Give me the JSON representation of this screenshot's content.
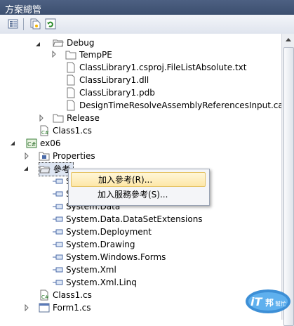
{
  "window": {
    "title": "方案總管"
  },
  "tree": {
    "debug": "Debug",
    "temppe": "TempPE",
    "file1": "ClassLibrary1.csproj.FileListAbsolute.txt",
    "file2": "ClassLibrary1.dll",
    "file3": "ClassLibrary1.pdb",
    "file4": "DesignTimeResolveAssemblyReferencesInput.cache",
    "release": "Release",
    "class1_top": "Class1.cs",
    "project": "ex06",
    "properties": "Properties",
    "references": "參考",
    "ref_partial1": "S",
    "ref_partial2": "S",
    "refs": [
      "System.Data",
      "System.Data.DataSetExtensions",
      "System.Deployment",
      "System.Drawing",
      "System.Windows.Forms",
      "System.Xml",
      "System.Xml.Linq"
    ],
    "class1": "Class1.cs",
    "form1": "Form1.cs"
  },
  "context_menu": {
    "add_reference": "加入參考(R)...",
    "add_service_reference": "加入服務參考(S)..."
  },
  "logo": {
    "text1": "iT",
    "text2": "邦",
    "text3": "幫忙"
  }
}
